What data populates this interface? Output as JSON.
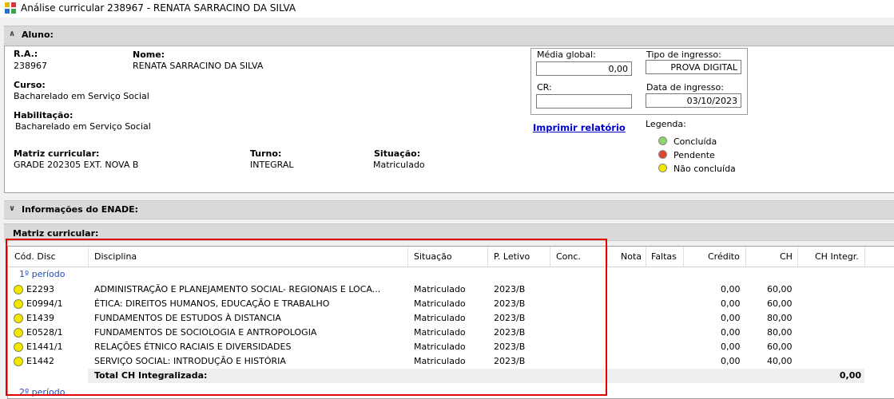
{
  "window": {
    "title": "Análise curricular 238967 - RENATA SARRACINO DA SILVA"
  },
  "aluno_section": {
    "label": "Aluno:"
  },
  "aluno": {
    "ra_label": "R.A.:",
    "ra": "238967",
    "nome_label": "Nome:",
    "nome": "RENATA SARRACINO DA SILVA",
    "curso_label": "Curso:",
    "curso": "Bacharelado em Serviço Social",
    "habilitacao_label": "Habilitação:",
    "habilitacao": "Bacharelado em Serviço Social",
    "matriz_label": "Matriz curricular:",
    "matriz": "GRADE 202305 EXT. NOVA B",
    "turno_label": "Turno:",
    "turno": "INTEGRAL",
    "situacao_label": "Situação:",
    "situacao": "Matriculado",
    "media_label": "Média global:",
    "media": "0,00",
    "tipo_label": "Tipo de ingresso:",
    "tipo": "PROVA DIGITAL",
    "cr_label": "CR:",
    "cr": "",
    "data_label": "Data de ingresso:",
    "data": "03/10/2023",
    "imprimir": "Imprimir relatório",
    "legenda_label": "Legenda:",
    "legenda": [
      {
        "label": "Concluída",
        "color": "#8fd36a"
      },
      {
        "label": "Pendente",
        "color": "#e0442e"
      },
      {
        "label": "Não concluída",
        "color": "#f5e800"
      }
    ]
  },
  "enade_section": {
    "label": "Informações do ENADE:"
  },
  "matriz_section": {
    "label": "Matriz curricular:"
  },
  "grid": {
    "headers": [
      "Cód. Disc",
      "Disciplina",
      "Situação",
      "P. Letivo",
      "Conc.",
      "Nota",
      "Faltas",
      "Crédito",
      "CH",
      "CH Integr."
    ],
    "periodo1": "1º período",
    "rows": [
      {
        "cod": "E2293",
        "disc": "ADMINISTRAÇÃO E PLANEJAMENTO SOCIAL- REGIONAIS E LOCA...",
        "sit": "Matriculado",
        "plet": "2023/B",
        "cred": "0,00",
        "ch": "60,00"
      },
      {
        "cod": "E0994/1",
        "disc": "ÉTICA: DIREITOS HUMANOS, EDUCAÇÃO E TRABALHO",
        "sit": "Matriculado",
        "plet": "2023/B",
        "cred": "0,00",
        "ch": "60,00"
      },
      {
        "cod": "E1439",
        "disc": "FUNDAMENTOS DE ESTUDOS À DISTANCIA",
        "sit": "Matriculado",
        "plet": "2023/B",
        "cred": "0,00",
        "ch": "80,00"
      },
      {
        "cod": "E0528/1",
        "disc": "FUNDAMENTOS DE SOCIOLOGIA E ANTROPOLOGIA",
        "sit": "Matriculado",
        "plet": "2023/B",
        "cred": "0,00",
        "ch": "80,00"
      },
      {
        "cod": "E1441/1",
        "disc": "RELAÇÕES ÉTNICO RACIAIS E DIVERSIDADES",
        "sit": "Matriculado",
        "plet": "2023/B",
        "cred": "0,00",
        "ch": "60,00"
      },
      {
        "cod": "E1442",
        "disc": "SERVIÇO SOCIAL: INTRODUÇÃO E HISTÓRIA",
        "sit": "Matriculado",
        "plet": "2023/B",
        "cred": "0,00",
        "ch": "40,00"
      }
    ],
    "total_label": "Total CH Integralizada:",
    "total_value": "0,00",
    "periodo2": "2º período"
  }
}
